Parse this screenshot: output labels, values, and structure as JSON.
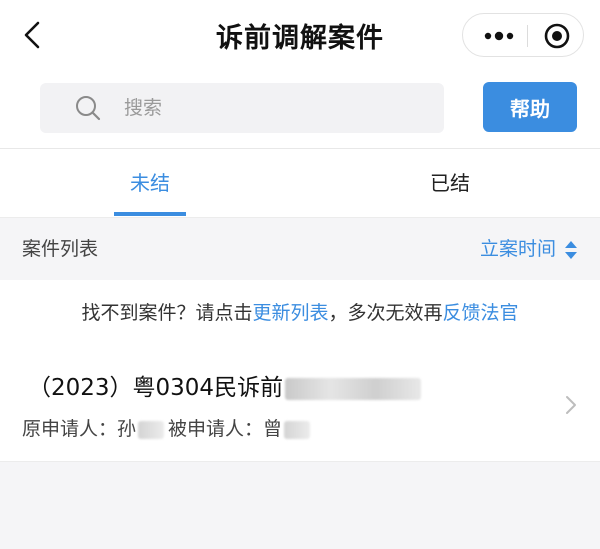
{
  "nav": {
    "title": "诉前调解案件",
    "icons": {
      "back": "chevron-left-icon",
      "more": "more-dots-icon",
      "close": "target-circle-icon"
    }
  },
  "search": {
    "placeholder": "搜索",
    "value": "",
    "help_label": "帮助",
    "icon": "search-icon"
  },
  "tabs": [
    {
      "label": "未结",
      "active": true
    },
    {
      "label": "已结",
      "active": false
    }
  ],
  "list": {
    "title": "案件列表",
    "sort_label": "立案时间",
    "sort_icon": "sort-updown-icon"
  },
  "notice": {
    "prefix": "找不到案件？请点击",
    "link1": "更新列表",
    "middle": "，多次无效再",
    "link2": "反馈法官"
  },
  "cases": [
    {
      "case_no": "（2023）粤0304民诉前",
      "applicant_label": "原申请人：",
      "applicant": "孙",
      "respondent_label": "被申请人：",
      "respondent": "曾"
    }
  ],
  "colors": {
    "accent": "#3b8de0",
    "background": "#f5f5f7",
    "text": "#222222"
  }
}
